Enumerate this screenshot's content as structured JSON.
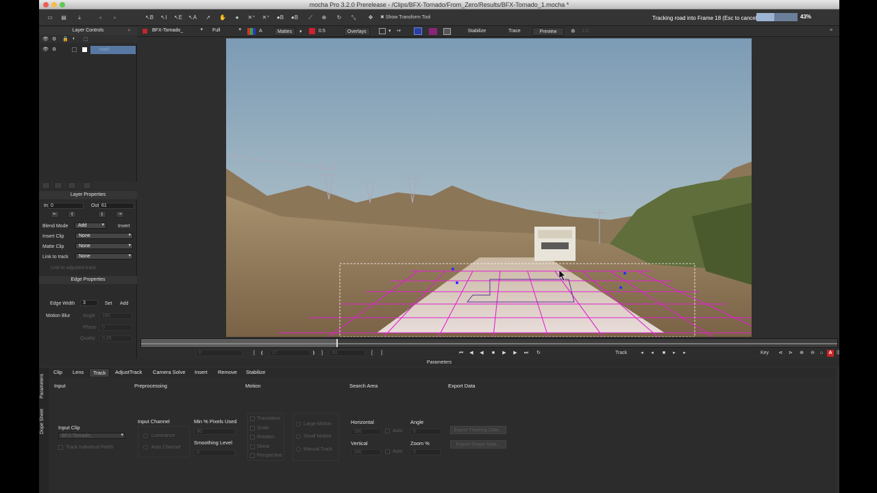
{
  "window": {
    "title": "mocha Pro 3.2.0 Prerelease - /Clips/BFX-Tornado/From_Zero/Results/BFX-Tornado_1.mocha *"
  },
  "toolbar": {
    "show_transform_tool": "Show Transform Tool",
    "tracking_status": "Tracking road into Frame 18 (Esc to cancel)",
    "progress_label": "43%",
    "progress_value": 0.43
  },
  "layer_controls": {
    "title": "Layer Controls",
    "layers": [
      {
        "name": "road",
        "selected": true
      }
    ]
  },
  "layer_properties": {
    "title": "Layer Properties",
    "in_label": "In",
    "in_value": "0",
    "out_label": "Out",
    "out_value": "61",
    "blend_mode_label": "Blend Mode",
    "blend_mode_value": "Add",
    "invert_label": "Invert",
    "insert_clip_label": "Insert Clip",
    "insert_clip_value": "None",
    "matte_clip_label": "Matte Clip",
    "matte_clip_value": "None",
    "link_to_track_label": "Link to track",
    "link_to_track_value": "None",
    "link_adjusted_label": "Link to adjusted track"
  },
  "edge_properties": {
    "title": "Edge Properties",
    "edge_width_label": "Edge Width",
    "edge_width_value": "3",
    "set_label": "Set",
    "add_label": "Add",
    "motion_blur_label": "Motion Blur",
    "angle_label": "Angle",
    "angle_value": "180",
    "phase_label": "Phase",
    "phase_value": "0",
    "quality_label": "Quality",
    "quality_value": "0.25"
  },
  "viewer_bar": {
    "clip_name": "BFX-Tornado_",
    "resolution": "Full",
    "channel": "A",
    "mattes_label": "Mattes",
    "opacity_value": "0.5",
    "overlays_label": "Overlays",
    "stabilize_label": "Stabilize",
    "trace_label": "Trace",
    "preview_label": "Preview",
    "zoom_value": "1.0"
  },
  "transport": {
    "frame_start": "0",
    "frame_current": "17",
    "frame_end": "61",
    "track_label": "Track",
    "key_label": "Key"
  },
  "parameters": {
    "title": "Parameters",
    "side_tabs": [
      "Parameters",
      "Dope Sheet"
    ],
    "tabs": [
      {
        "label": "Clip",
        "active": false
      },
      {
        "label": "Lens",
        "active": false
      },
      {
        "label": "Track",
        "active": true
      },
      {
        "label": "AdjustTrack",
        "active": false
      },
      {
        "label": "Camera Solve",
        "active": false
      },
      {
        "label": "Insert",
        "active": false
      },
      {
        "label": "Remove",
        "active": false
      },
      {
        "label": "Stabilize",
        "active": false
      }
    ],
    "sections": {
      "input": "Input",
      "preprocessing": "Preprocessing",
      "motion": "Motion",
      "search_area": "Search Area",
      "export_data": "Export Data"
    },
    "input_clip_label": "Input Clip",
    "input_clip_value": "BFX-Tornado_",
    "track_individual_fields": "Track Individual Fields",
    "input_channel_label": "Input Channel",
    "luminance_label": "Luminance",
    "auto_channel_label": "Auto Channel",
    "min_pixels_label": "Min % Pixels Used",
    "min_pixels_value": "90",
    "smoothing_label": "Smoothing Level",
    "smoothing_value": "0",
    "motion_options": [
      "Translation",
      "Scale",
      "Rotation",
      "Shear",
      "Perspective"
    ],
    "motion_modes": [
      "Large Motion",
      "Small Motion",
      "Manual Track"
    ],
    "horizontal_label": "Horizontal",
    "horizontal_value": "180",
    "vertical_label": "Vertical",
    "vertical_value": "180",
    "auto_label": "Auto",
    "angle_label": "Angle",
    "angle_value": "0",
    "zoom_label": "Zoom %",
    "zoom_value": "0",
    "export_tracking_label": "Export Tracking Data...",
    "export_shape_label": "Export Shape Data..."
  }
}
